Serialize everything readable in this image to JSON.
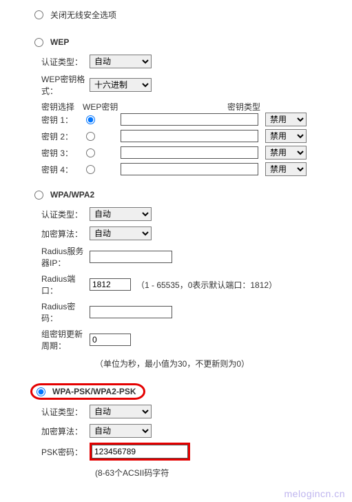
{
  "security": {
    "disable_label": "关闭无线安全选项"
  },
  "wep": {
    "title": "WEP",
    "auth_label": "认证类型：",
    "auth_value": "自动",
    "format_label": "WEP密钥格式：",
    "format_value": "十六进制",
    "col_select": "密钥选择",
    "col_key": "WEP密钥",
    "col_type": "密钥类型",
    "rows": [
      {
        "label": "密钥 1：",
        "value": "",
        "type": "禁用",
        "selected": true
      },
      {
        "label": "密钥 2：",
        "value": "",
        "type": "禁用",
        "selected": false
      },
      {
        "label": "密钥 3：",
        "value": "",
        "type": "禁用",
        "selected": false
      },
      {
        "label": "密钥 4：",
        "value": "",
        "type": "禁用",
        "selected": false
      }
    ]
  },
  "wpa": {
    "title": "WPA/WPA2",
    "auth_label": "认证类型：",
    "auth_value": "自动",
    "enc_label": "加密算法：",
    "enc_value": "自动",
    "radius_ip_label": "Radius服务器IP：",
    "radius_ip_value": "",
    "radius_port_label": "Radius端口：",
    "radius_port_value": "1812",
    "radius_port_note": "（1 - 65535，0表示默认端口：1812）",
    "radius_pwd_label": "Radius密码：",
    "radius_pwd_value": "",
    "group_key_label": "组密钥更新周期：",
    "group_key_value": "0",
    "group_key_note": "（单位为秒，最小值为30，不更新则为0）"
  },
  "psk": {
    "title": "WPA-PSK/WPA2-PSK",
    "auth_label": "认证类型：",
    "auth_value": "自动",
    "enc_label": "加密算法：",
    "enc_value": "自动",
    "psk_label": "PSK密码：",
    "psk_value": "123456789",
    "psk_note": "(8-63个ACSII码字符"
  },
  "footer": {
    "watermark": "melogincn.cn"
  }
}
